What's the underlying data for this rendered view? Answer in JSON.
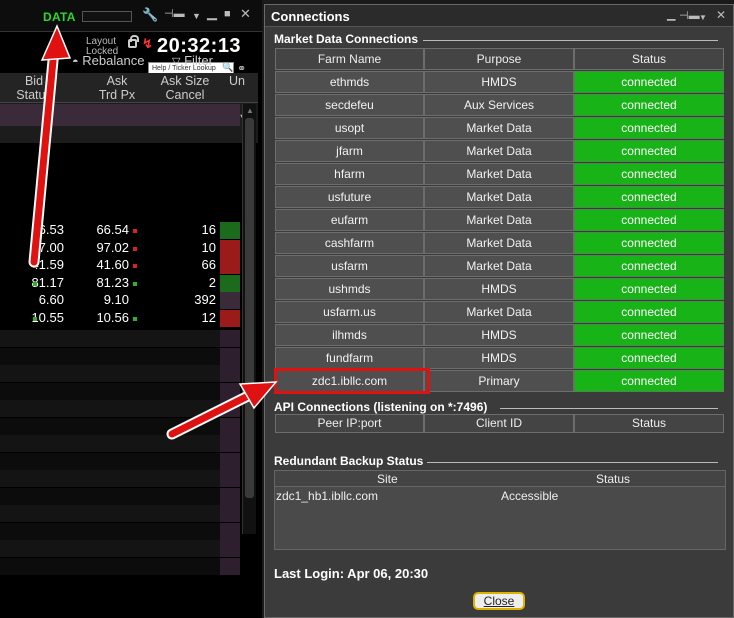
{
  "trading": {
    "data_label": "DATA",
    "layout_line1": "Layout",
    "layout_line2": "Locked",
    "clock": "20:32:13",
    "ticker_placeholder": "Help / Ticker Lookup",
    "toolbar": {
      "rebalance": "Rebalance",
      "filter": "Filter"
    },
    "columns": [
      {
        "top": "Bid",
        "bottom": "Status"
      },
      {
        "top": "Ask",
        "bottom": "Trd Px"
      },
      {
        "top": "Ask Size",
        "bottom": "Cancel"
      },
      {
        "top": "Un",
        "bottom": ""
      }
    ],
    "quotes": [
      {
        "bid": "66.53",
        "ask": "66.54",
        "size": "16",
        "dot1": "#e02020",
        "dot2": "#e02020",
        "flag": "#1c6b1c"
      },
      {
        "bid": "97.00",
        "ask": "97.02",
        "size": "10",
        "dot1": "#e02020",
        "dot2": "#e02020",
        "flag": "#9b1a1a"
      },
      {
        "bid": "41.59",
        "ask": "41.60",
        "size": "66",
        "dot1": "#e02020",
        "dot2": "#e02020",
        "flag": "#9b1a1a"
      },
      {
        "bid": "81.17",
        "ask": "81.23",
        "size": "2",
        "dot1": "#2bb32b",
        "dot2": "#2bb32b",
        "flag": "#1c6b1c"
      },
      {
        "bid": "6.60",
        "ask": "9.10",
        "size": "392",
        "dot1": "",
        "dot2": "",
        "flag": "#3a2a3a"
      },
      {
        "bid": "10.55",
        "ask": "10.56",
        "size": "12",
        "dot1": "#2bb32b",
        "dot2": "#2bb32b",
        "flag": "#9b1a1a"
      }
    ]
  },
  "dialog": {
    "title": "Connections",
    "market_section": "Market Data Connections",
    "headers": [
      "Farm Name",
      "Purpose",
      "Status"
    ],
    "farms": [
      {
        "name": "ethmds",
        "purpose": "HMDS",
        "status": "connected"
      },
      {
        "name": "secdefeu",
        "purpose": "Aux Services",
        "status": "connected"
      },
      {
        "name": "usopt",
        "purpose": "Market Data",
        "status": "connected"
      },
      {
        "name": "jfarm",
        "purpose": "Market Data",
        "status": "connected"
      },
      {
        "name": "hfarm",
        "purpose": "Market Data",
        "status": "connected"
      },
      {
        "name": "usfuture",
        "purpose": "Market Data",
        "status": "connected"
      },
      {
        "name": "eufarm",
        "purpose": "Market Data",
        "status": "connected"
      },
      {
        "name": "cashfarm",
        "purpose": "Market Data",
        "status": "connected"
      },
      {
        "name": "usfarm",
        "purpose": "Market Data",
        "status": "connected"
      },
      {
        "name": "ushmds",
        "purpose": "HMDS",
        "status": "connected"
      },
      {
        "name": "usfarm.us",
        "purpose": "Market Data",
        "status": "connected"
      },
      {
        "name": "ilhmds",
        "purpose": "HMDS",
        "status": "connected"
      },
      {
        "name": "fundfarm",
        "purpose": "HMDS",
        "status": "connected"
      },
      {
        "name": "zdc1.ibllc.com",
        "purpose": "Primary",
        "status": "connected"
      }
    ],
    "api_section": "API Connections (listening on *:7496)",
    "api_headers": [
      "Peer IP:port",
      "Client ID",
      "Status"
    ],
    "backup_section": "Redundant Backup Status",
    "backup_headers": [
      "Site",
      "Status"
    ],
    "backup_rows": [
      {
        "site": "zdc1_hb1.ibllc.com",
        "status": "Accessible"
      }
    ],
    "last_login": "Last Login: Apr 06, 20:30",
    "close_label": "Close"
  },
  "colors": {
    "connected": "#17b317",
    "data_green": "#2dd82d",
    "annotation_red": "#e01111",
    "close_border": "#d9b300"
  }
}
